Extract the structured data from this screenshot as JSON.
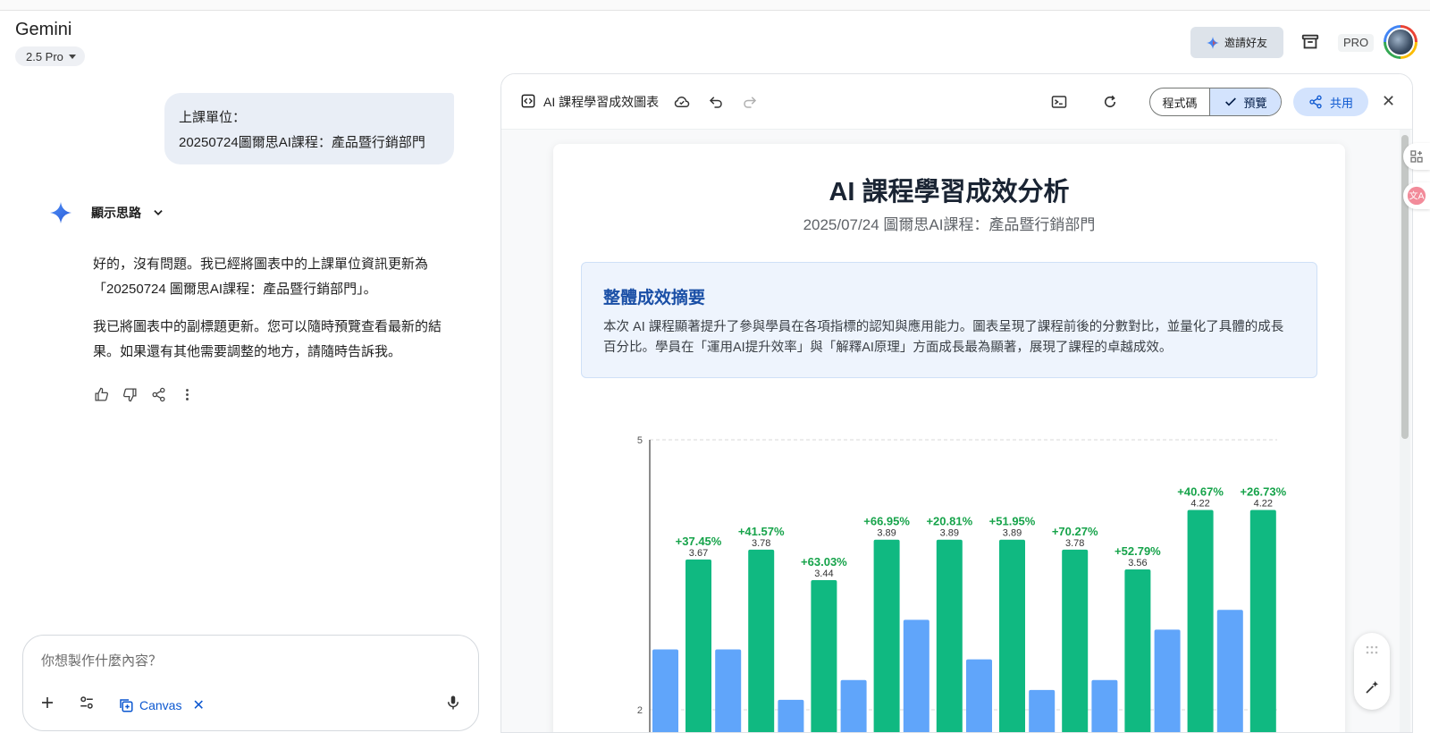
{
  "app": {
    "title": "Gemini",
    "model": "2.5 Pro"
  },
  "header": {
    "invite_label": "邀請好友",
    "pro_label": "PRO"
  },
  "chat": {
    "user_message": {
      "line1": "上課單位：",
      "line2": "20250724圖爾思AI課程：產品暨行銷部門"
    },
    "thoughts_label": "顯示思路",
    "reply_paragraphs": [
      "好的，沒有問題。我已經將圖表中的上課單位資訊更新為「20250724 圖爾思AI課程：產品暨行銷部門」。",
      "我已將圖表中的副標題更新。您可以隨時預覽查看最新的結果。如果還有其他需要調整的地方，請隨時告訴我。"
    ]
  },
  "composer": {
    "placeholder": "你想製作什麼內容？",
    "canvas_label": "Canvas"
  },
  "canvas_panel": {
    "doc_title": "AI 課程學習成效圖表",
    "code_label": "程式碼",
    "preview_label": "預覽",
    "share_label": "共用"
  },
  "document": {
    "title": "AI 課程學習成效分析",
    "subtitle": "2025/07/24 圖爾思AI課程：產品暨行銷部門",
    "summary_heading": "整體成效摘要",
    "summary_text": "本次 AI 課程顯著提升了參與學員在各項指標的認知與應用能力。圖表呈現了課程前後的分數對比，並量化了具體的成長百分比。學員在「運用AI提升效率」與「解釋AI原理」方面成長最為顯著，展現了課程的卓越成效。"
  },
  "chart_data": {
    "type": "bar",
    "ylim": [
      2,
      5
    ],
    "y_ticks_visible": [
      2,
      5
    ],
    "grid": true,
    "series": [
      {
        "values": [
          2.67,
          2.67,
          2.11,
          2.33,
          3.0,
          2.56,
          2.22,
          2.33,
          2.89,
          3.11
        ],
        "color": "#60a5fa"
      },
      {
        "values": [
          3.67,
          3.78,
          3.44,
          3.89,
          3.89,
          3.89,
          3.78,
          3.56,
          4.22,
          4.22
        ],
        "color": "#10b981"
      }
    ],
    "value_labels": [
      "3.67",
      "3.78",
      "3.44",
      "3.89",
      "3.89",
      "3.89",
      "3.78",
      "3.56",
      "4.22",
      "4.22"
    ],
    "growth_labels": [
      "+37.45%",
      "+41.57%",
      "+63.03%",
      "+66.95%",
      "+20.81%",
      "+51.95%",
      "+70.27%",
      "+52.79%",
      "+40.67%",
      "+26.73%"
    ]
  }
}
